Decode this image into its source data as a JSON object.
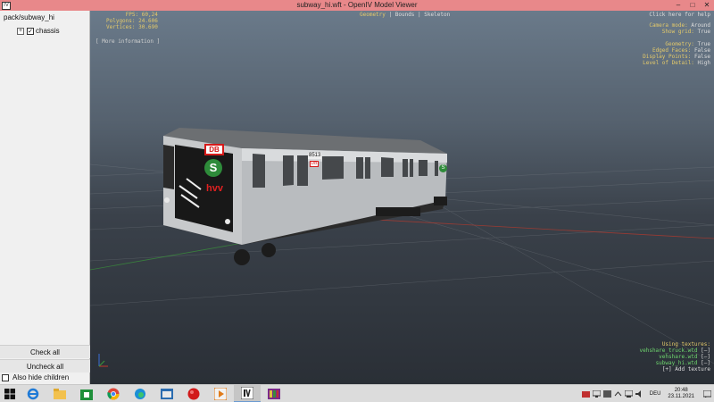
{
  "window": {
    "title": "subway_hi.wft - OpenIV Model Viewer",
    "app_icon": "IV",
    "controls": {
      "minimize": "–",
      "maximize": "□",
      "close": "✕"
    }
  },
  "tree": {
    "root_label": "pack/subway_hi",
    "child_label": "chassis",
    "child_checked": true
  },
  "panel": {
    "check_all": "Check all",
    "uncheck_all": "Uncheck all",
    "also_hide_children": "Also hide children"
  },
  "viewport": {
    "stats": {
      "fps_label": "FPS:",
      "fps": "60,24",
      "polygons_label": "Polygons:",
      "polygons": "24.606",
      "vertices_label": "Vertices:",
      "vertices": "30.690"
    },
    "more_information": "[ More information ]",
    "tabs": [
      "Geometry",
      "Bounds",
      "Skeleton"
    ],
    "active_tab": "Geometry",
    "help_text": "Click here for help",
    "settings": [
      {
        "key": "Camera mode:",
        "value": "Around"
      },
      {
        "key": "Show grid:",
        "value": "True"
      },
      {
        "key": "",
        "value": ""
      },
      {
        "key": "Geometry:",
        "value": "True"
      },
      {
        "key": "Edged Faces:",
        "value": "False"
      },
      {
        "key": "Display Points:",
        "value": "False"
      },
      {
        "key": "Level of Detail:",
        "value": "High"
      }
    ],
    "textures_title": "Using textures:",
    "textures": [
      "vehshare_truck.wtd",
      "vehshare.wtd",
      "subway_hi.wtd"
    ],
    "texture_suffix": "[–]",
    "add_texture": "[+] Add texture",
    "train_labels": {
      "db": "DB",
      "s_line": "S",
      "hvv": "hvv",
      "car_number": "8513",
      "db_small": "DB",
      "route_sign": "S"
    }
  },
  "taskbar": {
    "language": "DEU",
    "time": "20:48",
    "date": "23.11.2021"
  },
  "colors": {
    "title_bar": "#e8888a",
    "hud_yellow": "#e3c96a",
    "texture_green": "#6ed66e",
    "db_red": "#d61a1a",
    "s_green": "#2e8b3a"
  }
}
